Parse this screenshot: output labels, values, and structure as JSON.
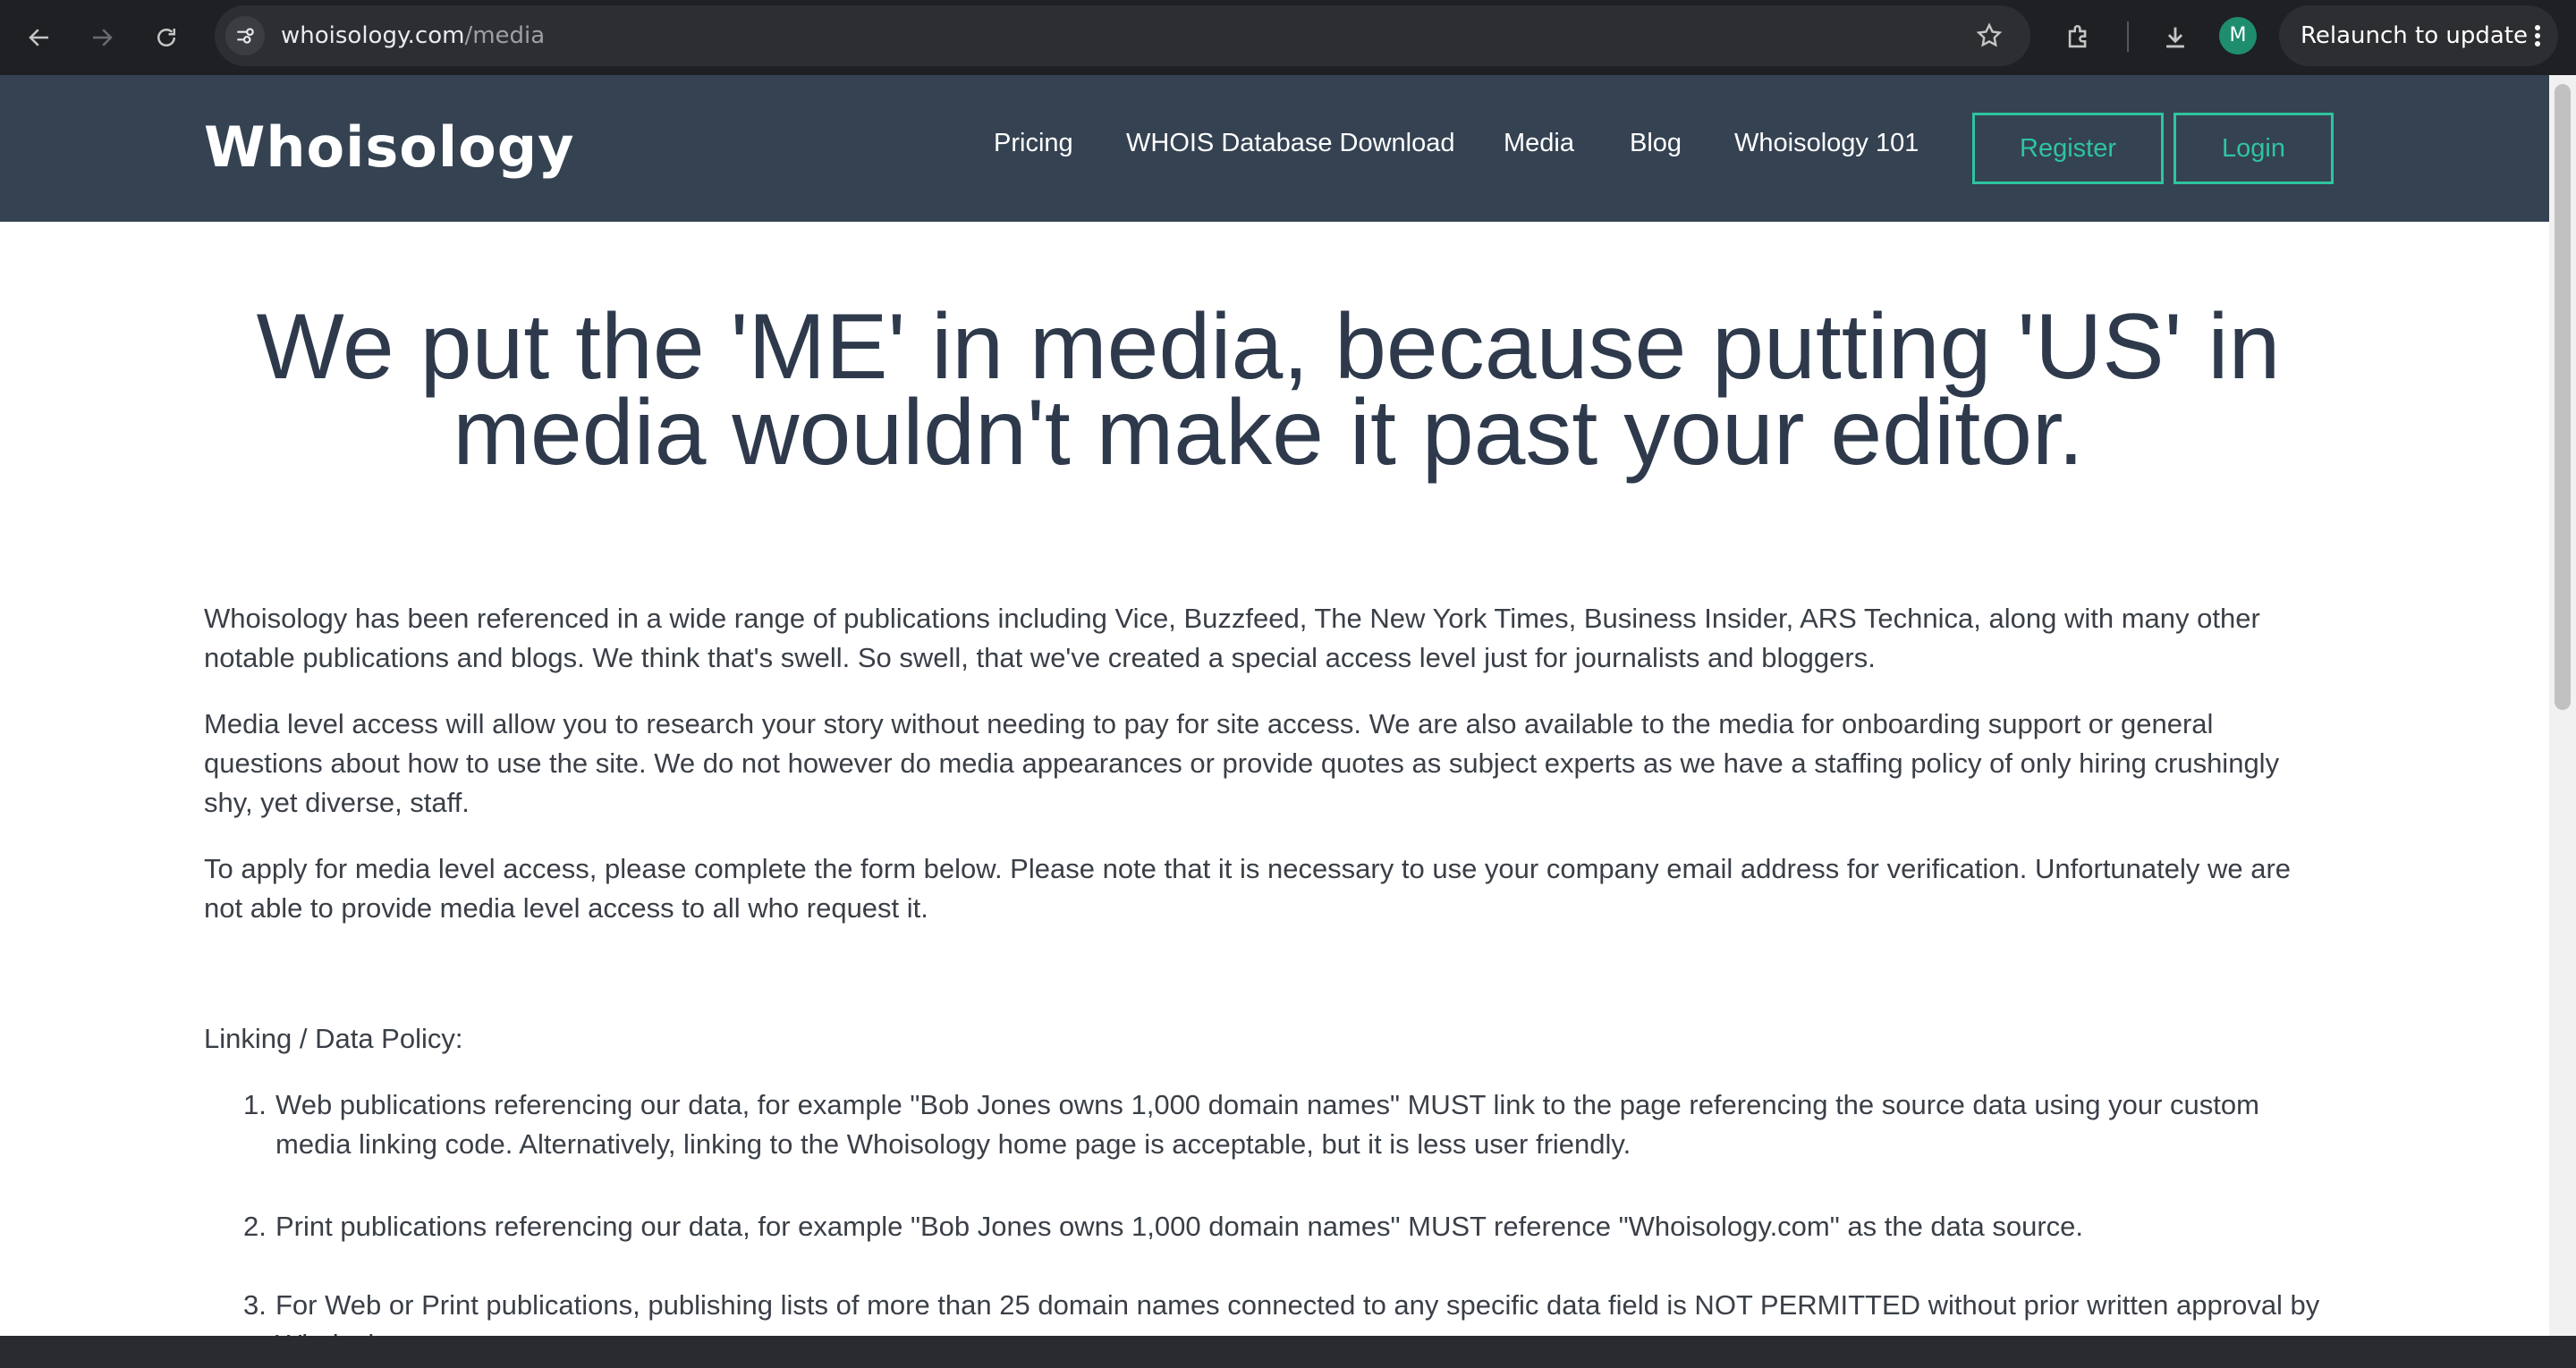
{
  "browser": {
    "url_domain": "whoisology.com",
    "url_path": "/media",
    "avatar_letter": "M",
    "relaunch_label": "Relaunch to update"
  },
  "header": {
    "logo": "Whoisology",
    "nav": [
      "Pricing",
      "WHOIS Database Download",
      "Media",
      "Blog",
      "Whoisology 101"
    ],
    "register_label": "Register",
    "login_label": "Login",
    "accent_color": "#2ec4a0",
    "background_color": "#354252"
  },
  "main": {
    "hero": "We put the 'ME' in media, because putting 'US' in media wouldn't make it past your editor.",
    "paragraphs": [
      "Whoisology has been referenced in a wide range of publications including Vice, Buzzfeed, The New York Times, Business Insider, ARS Technica, along with many other notable publications and blogs. We think that's swell. So swell, that we've created a special access level just for journalists and bloggers.",
      "Media level access will allow you to research your story without needing to pay for site access. We are also available to the media for onboarding support or general questions about how to use the site. We do not however do media appearances or provide quotes as subject experts as we have a staffing policy of only hiring crushingly shy, yet diverse, staff.",
      "To apply for media level access, please complete the form below. Please note that it is necessary to use your company email address for verification. Unfortunately we are not able to provide media level access to all who request it."
    ],
    "policy_heading": "Linking / Data Policy:",
    "policy_items": [
      {
        "num": "1.",
        "text": "Web publications referencing our data, for example \"Bob Jones owns 1,000 domain names\" MUST link to the page referencing the source data using your custom media linking code. Alternatively, linking to the Whoisology home page is acceptable, but it is less user friendly."
      },
      {
        "num": "2.",
        "text": "Print publications referencing our data, for example \"Bob Jones owns 1,000 domain names\" MUST reference \"Whoisology.com\" as the data source."
      },
      {
        "num": "3.",
        "text": "For Web or Print publications, publishing lists of more than 25 domain names connected to any specific data field is NOT PERMITTED without prior written approval by Whoisology."
      }
    ]
  }
}
